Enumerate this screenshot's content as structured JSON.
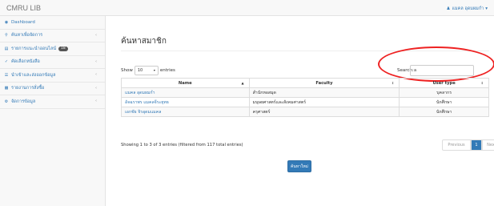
{
  "app": {
    "brand": "CMRU LIB",
    "user": "แมคล อุดมผมกำ"
  },
  "sidebar": {
    "items": [
      {
        "label": "Dashboard",
        "icon": "dashboard-icon",
        "expandable": false
      },
      {
        "label": "ค้นหาเพื่อจัดการ",
        "icon": "search-icon",
        "expandable": true
      },
      {
        "label": "รายการแนะนำออนไลน์",
        "icon": "cart-icon",
        "expandable": false,
        "badge": "18"
      },
      {
        "label": "คัดเลือกหนังสือ",
        "icon": "check-icon",
        "expandable": true
      },
      {
        "label": "นำเข้าและส่งออกข้อมูล",
        "icon": "list-icon",
        "expandable": true
      },
      {
        "label": "รายงานการสั่งซื้อ",
        "icon": "chart-icon",
        "expandable": true
      },
      {
        "label": "จัดการข้อมูล",
        "icon": "gear-icon",
        "expandable": true
      }
    ]
  },
  "main": {
    "title": "ค้นหาสมาชิก",
    "show_label": "Show",
    "entries_value": "10",
    "entries_label": "entries",
    "search_label": "Search:",
    "search_value": "a",
    "table": {
      "columns": [
        "Name",
        "Faculty",
        "User type"
      ],
      "rows": [
        {
          "name": "แมคล อุดมผมกำ",
          "faculty": "สำนักหอสมุด",
          "usertype": "บุคลากร"
        },
        {
          "name": "อัจฉราพร แมคลจีระยุทธ",
          "faculty": "มนุษยศาสตร์และสังคมศาสตร์",
          "usertype": "นักศึกษา"
        },
        {
          "name": "เอกชัย จิรอุดมแมคล",
          "faculty": "ครุศาสตร์",
          "usertype": "นักศึกษา"
        }
      ]
    },
    "info": "Showing 1 to 3 of 3 entries (filtered from 117 total entries)",
    "pagination": {
      "prev": "Previous",
      "page": "1",
      "next": "Next"
    },
    "new_button": "ค้นหาใหม่"
  },
  "colors": {
    "link": "#337ab7",
    "highlight": "#e22222"
  }
}
